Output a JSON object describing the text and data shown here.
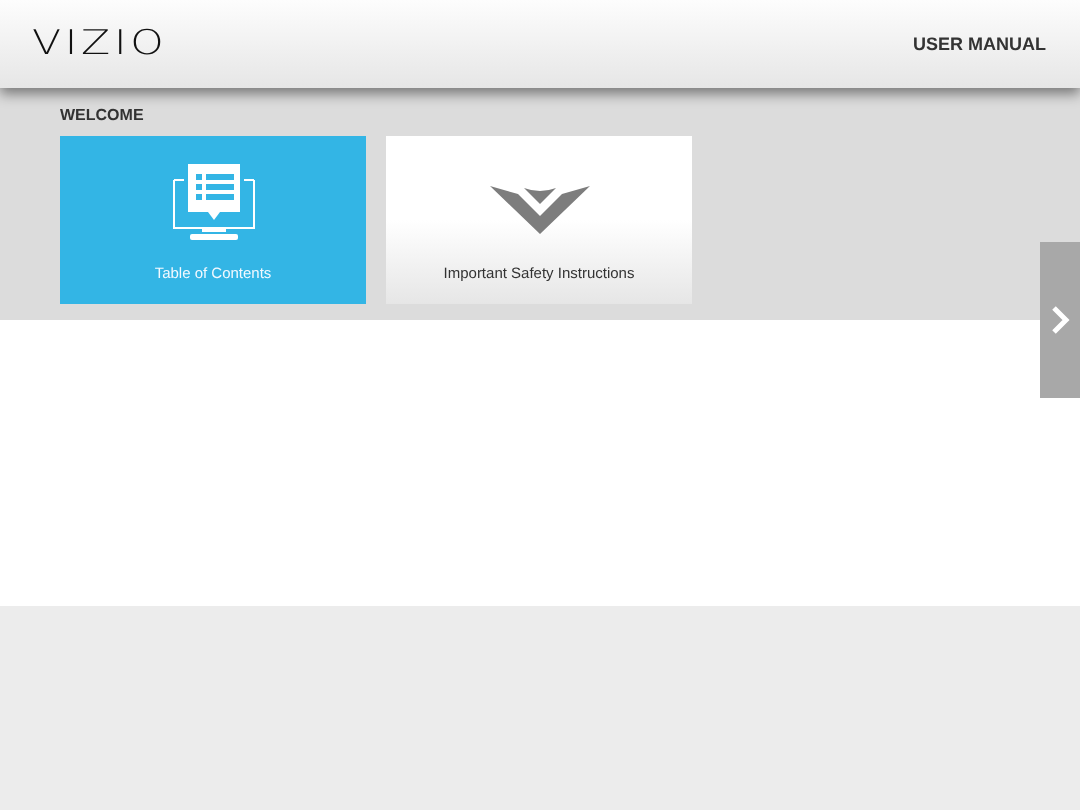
{
  "header": {
    "logo": "VIZIO",
    "title": "USER MANUAL"
  },
  "section": {
    "heading": "WELCOME"
  },
  "tiles": [
    {
      "label": "Table of Contents",
      "kind": "contents",
      "selected": true
    },
    {
      "label": "Important Safety Instructions",
      "kind": "brand",
      "selected": false
    }
  ]
}
